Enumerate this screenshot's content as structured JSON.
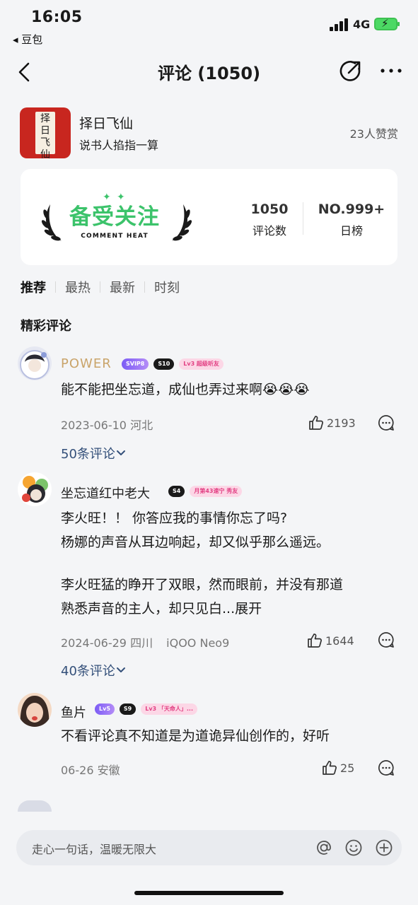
{
  "status_bar": {
    "time": "16:05",
    "back_app": "◂ 豆包",
    "network": "4G"
  },
  "nav": {
    "title": "评论 (1050)"
  },
  "album": {
    "title": "择日飞仙",
    "author": "说书人掐指一算",
    "likes": "23人赞赏",
    "cover_text": "择日飞仙"
  },
  "heat": {
    "badge_title": "备受关注",
    "badge_subtitle": "COMMENT HEAT",
    "stats": [
      {
        "value": "1050",
        "label": "评论数"
      },
      {
        "value": "NO.999+",
        "label": "日榜"
      }
    ]
  },
  "sort_tabs": [
    "推荐",
    "最热",
    "最新",
    "时刻"
  ],
  "section_title": "精彩评论",
  "comments": [
    {
      "username": "POWER",
      "badges": [
        "SVIP8",
        "S10",
        "Lv3 超级听友"
      ],
      "text": "能不能把坐忘道，成仙也弄过来啊😭😭😭",
      "date": "2023-06-10 河北",
      "likes": "2193",
      "replies": "50条评论"
    },
    {
      "username": "坐忘道红中老大",
      "badges": [
        "S4",
        "月第43速宁 秀友"
      ],
      "text_lines": [
        "李火旺！！ 你答应我的事情你忘了吗?",
        "杨娜的声音从耳边响起，却又似乎那么遥远。",
        "",
        "李火旺猛的睁开了双眼，然而眼前，并没有那道",
        "熟悉声音的主人，却只见白...展开"
      ],
      "date": "2024-06-29 四川",
      "device": "iQOO Neo9",
      "likes": "1644",
      "replies": "40条评论"
    },
    {
      "username": "鱼片",
      "badges": [
        "Lv5",
        "S9",
        "Lv3 「天命人」..."
      ],
      "text": "不看评论真不知道是为道诡异仙创作的，好听",
      "date": "06-26 安徽",
      "likes": "25"
    }
  ],
  "input": {
    "placeholder": "走心一句话，温暖无限大"
  },
  "colors": {
    "accent_green": "#3cc36b",
    "link_blue": "#34507a",
    "username_gold": "#c9a46a"
  }
}
